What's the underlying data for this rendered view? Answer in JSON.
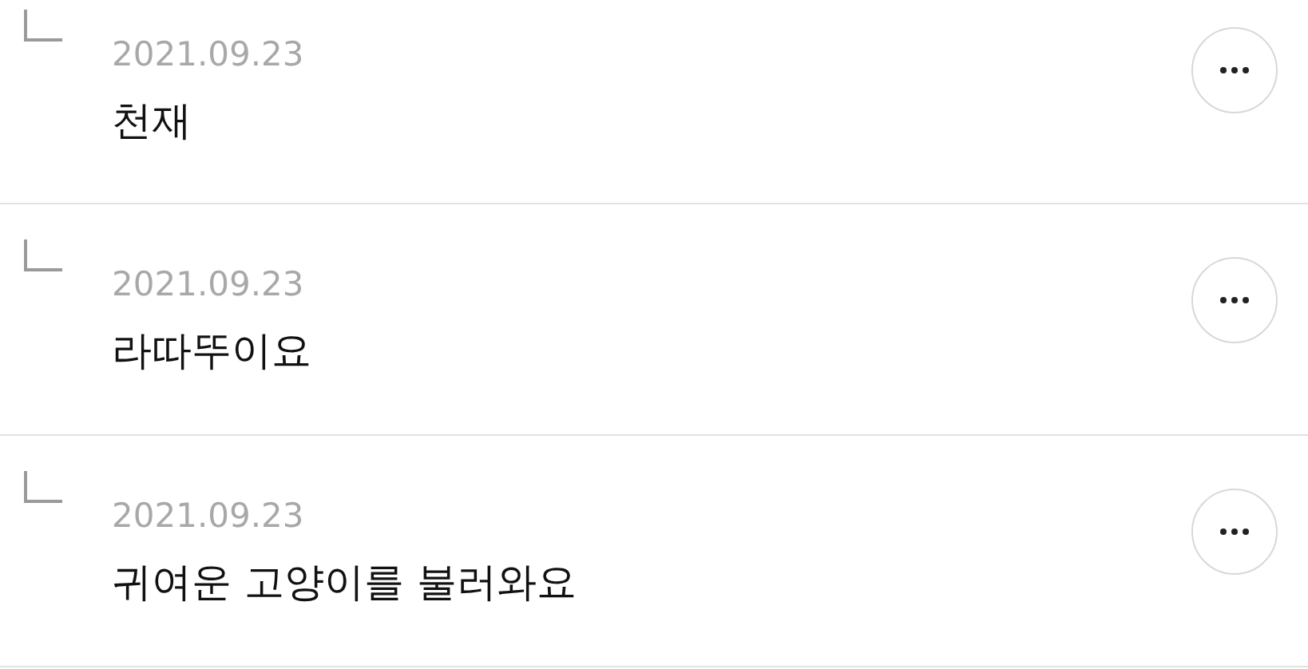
{
  "replies": [
    {
      "date": "2021.09.23",
      "text": "천재"
    },
    {
      "date": "2021.09.23",
      "text": "라따뚜이요"
    },
    {
      "date": "2021.09.23",
      "text": "귀여운 고양이를 불러와요"
    }
  ]
}
